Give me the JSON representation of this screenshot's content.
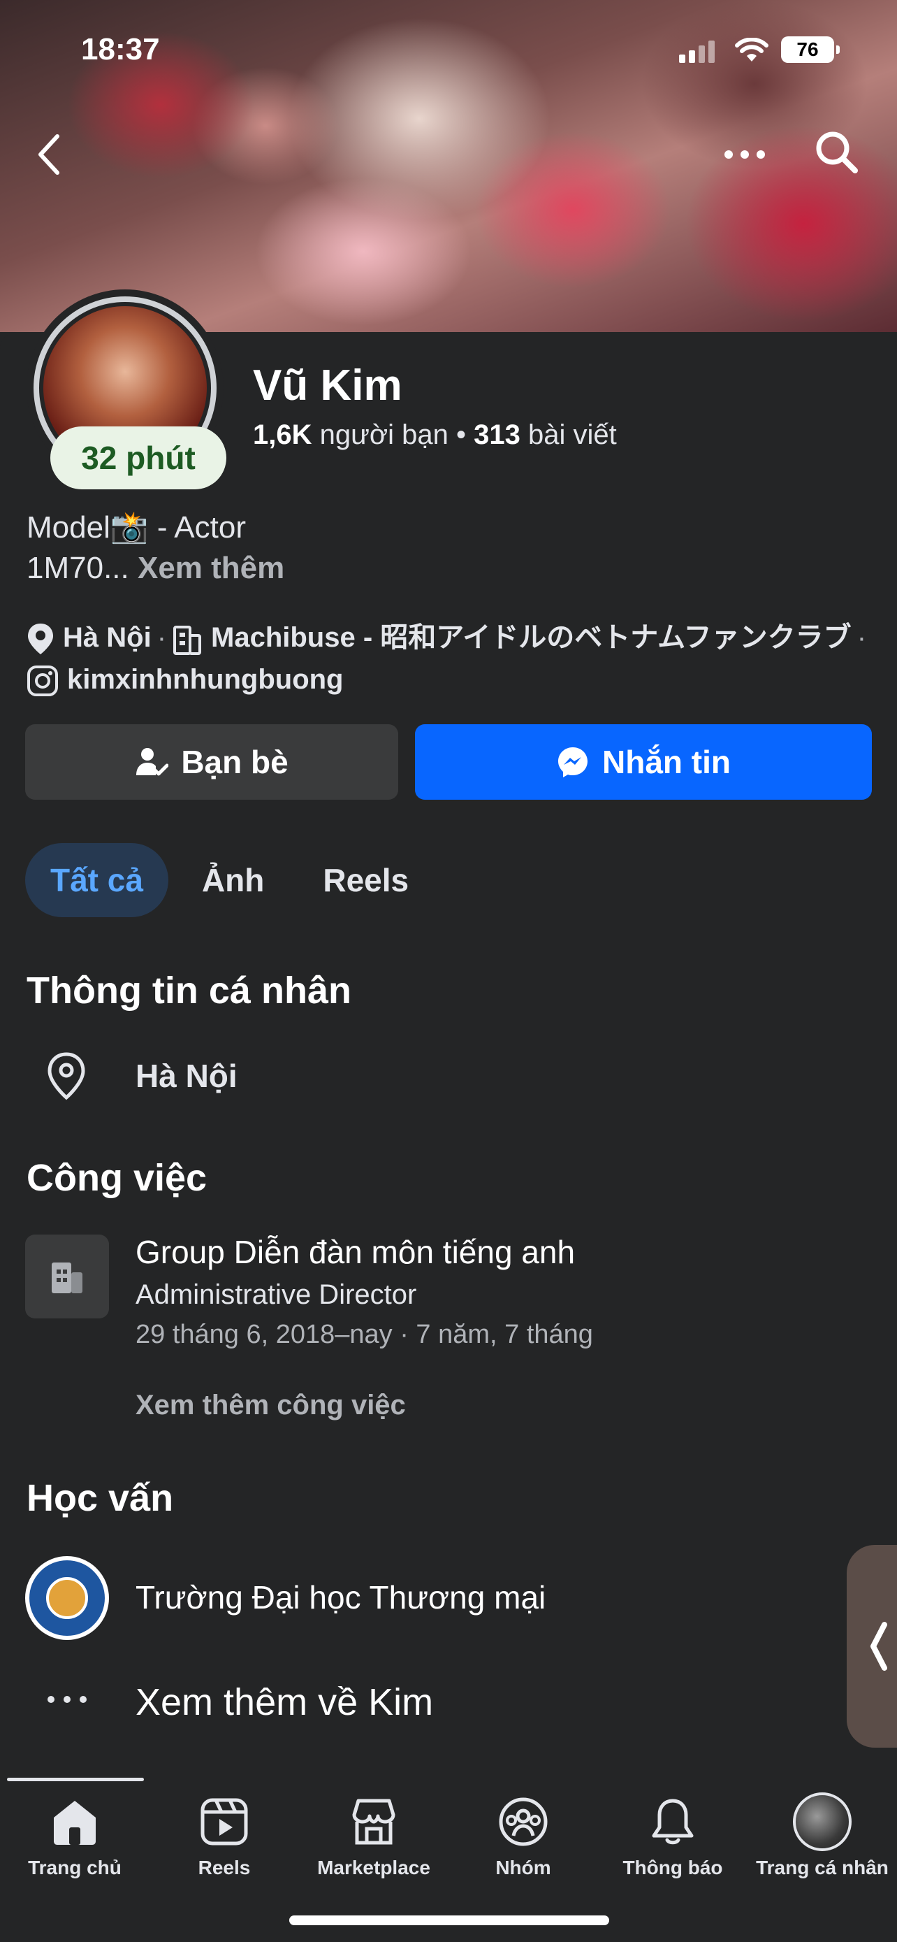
{
  "status_bar": {
    "time": "18:37",
    "battery": "76"
  },
  "profile": {
    "story_label": "32 phút",
    "name": "Vũ Kim",
    "friends_count": "1,6K",
    "friends_label": "người bạn",
    "dot": "•",
    "posts_count": "313",
    "posts_label": "bài viết",
    "bio_line1": "Model📸 - Actor",
    "bio_line2": "1M70...",
    "bio_more": "Xem thêm",
    "location": "Hà Nội",
    "workplace": "Machibuse - 昭和アイドルのベトナムファンクラブ",
    "instagram": "kimxinhnhungbuong",
    "separator": "·"
  },
  "actions": {
    "friends_button": "Bạn bè",
    "message_button": "Nhắn tin"
  },
  "tabs": [
    {
      "label": "Tất cả",
      "active": true
    },
    {
      "label": "Ảnh",
      "active": false
    },
    {
      "label": "Reels",
      "active": false
    }
  ],
  "about": {
    "personal_title": "Thông tin cá nhân",
    "city": "Hà Nội",
    "work_title": "Công việc",
    "work_company": "Group Diễn đàn môn tiếng anh",
    "work_role": "Administrative Director",
    "work_dates": "29 tháng 6, 2018–nay · 7 năm, 7 tháng",
    "work_more": "Xem thêm công việc",
    "education_title": "Học vấn",
    "school": "Trường Đại học Thương mại",
    "see_more_about": "Xem thêm về Kim"
  },
  "nav": [
    {
      "label": "Trang chủ",
      "icon": "home-icon",
      "active": true
    },
    {
      "label": "Reels",
      "icon": "reels-icon",
      "active": false
    },
    {
      "label": "Marketplace",
      "icon": "marketplace-icon",
      "active": false
    },
    {
      "label": "Nhóm",
      "icon": "groups-icon",
      "active": false
    },
    {
      "label": "Thông báo",
      "icon": "bell-icon",
      "active": false
    },
    {
      "label": "Trang cá nhân",
      "icon": "profile-avatar",
      "active": false
    }
  ],
  "colors": {
    "accent": "#0866ff",
    "tab_active_bg": "#263951",
    "tab_active_text": "#5aa7ff",
    "background": "#242526"
  }
}
